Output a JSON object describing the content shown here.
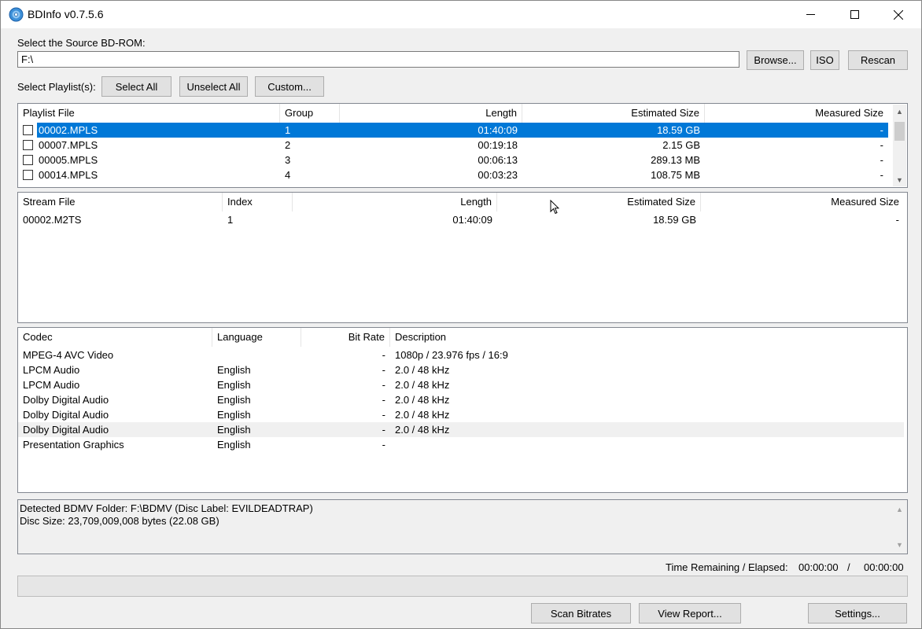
{
  "window": {
    "title": "BDInfo v0.7.5.6"
  },
  "source": {
    "label": "Select the Source BD-ROM:",
    "path": "F:\\",
    "browse_label": "Browse...",
    "iso_label": "ISO",
    "rescan_label": "Rescan"
  },
  "playlists_bar": {
    "label": "Select Playlist(s):",
    "select_all_label": "Select All",
    "unselect_all_label": "Unselect All",
    "custom_label": "Custom..."
  },
  "playlist_table": {
    "headers": [
      "Playlist File",
      "Group",
      "Length",
      "Estimated Size",
      "Measured Size"
    ],
    "rows": [
      {
        "file": "00002.MPLS",
        "group": "1",
        "length": "01:40:09",
        "est": "18.59 GB",
        "meas": "-"
      },
      {
        "file": "00007.MPLS",
        "group": "2",
        "length": "00:19:18",
        "est": "2.15 GB",
        "meas": "-"
      },
      {
        "file": "00005.MPLS",
        "group": "3",
        "length": "00:06:13",
        "est": "289.13 MB",
        "meas": "-"
      },
      {
        "file": "00014.MPLS",
        "group": "4",
        "length": "00:03:23",
        "est": "108.75 MB",
        "meas": "-"
      }
    ]
  },
  "stream_table": {
    "headers": [
      "Stream File",
      "Index",
      "Length",
      "Estimated Size",
      "Measured Size"
    ],
    "rows": [
      {
        "file": "00002.M2TS",
        "index": "1",
        "length": "01:40:09",
        "est": "18.59 GB",
        "meas": "-"
      }
    ]
  },
  "codec_table": {
    "headers": [
      "Codec",
      "Language",
      "Bit Rate",
      "Description"
    ],
    "rows": [
      {
        "codec": "MPEG-4 AVC Video",
        "lang": "",
        "bitrate": "-",
        "desc": "1080p / 23.976 fps / 16:9"
      },
      {
        "codec": "LPCM Audio",
        "lang": "English",
        "bitrate": "-",
        "desc": "2.0 / 48 kHz"
      },
      {
        "codec": "LPCM Audio",
        "lang": "English",
        "bitrate": "-",
        "desc": "2.0 / 48 kHz"
      },
      {
        "codec": "Dolby Digital Audio",
        "lang": "English",
        "bitrate": "-",
        "desc": "2.0 / 48 kHz"
      },
      {
        "codec": "Dolby Digital Audio",
        "lang": "English",
        "bitrate": "-",
        "desc": "2.0 / 48 kHz"
      },
      {
        "codec": "Dolby Digital Audio",
        "lang": "English",
        "bitrate": "-",
        "desc": "2.0 / 48 kHz"
      },
      {
        "codec": "Presentation Graphics",
        "lang": "English",
        "bitrate": "-",
        "desc": ""
      }
    ]
  },
  "status": {
    "line1": "Detected BDMV Folder: F:\\BDMV (Disc Label: EVILDEADTRAP)",
    "line2": "Disc Size: 23,709,009,008 bytes (22.08 GB)"
  },
  "timer": {
    "label": "Time Remaining / Elapsed:",
    "remaining": "00:00:00",
    "separator": "/",
    "elapsed": "00:00:00"
  },
  "progress": {
    "value": 0
  },
  "actions": {
    "scan_label": "Scan Bitrates",
    "report_label": "View Report...",
    "settings_label": "Settings..."
  },
  "colors": {
    "selection": "#0078d7",
    "title_bg": "#ffffff",
    "window_bg": "#f0f0f0"
  }
}
